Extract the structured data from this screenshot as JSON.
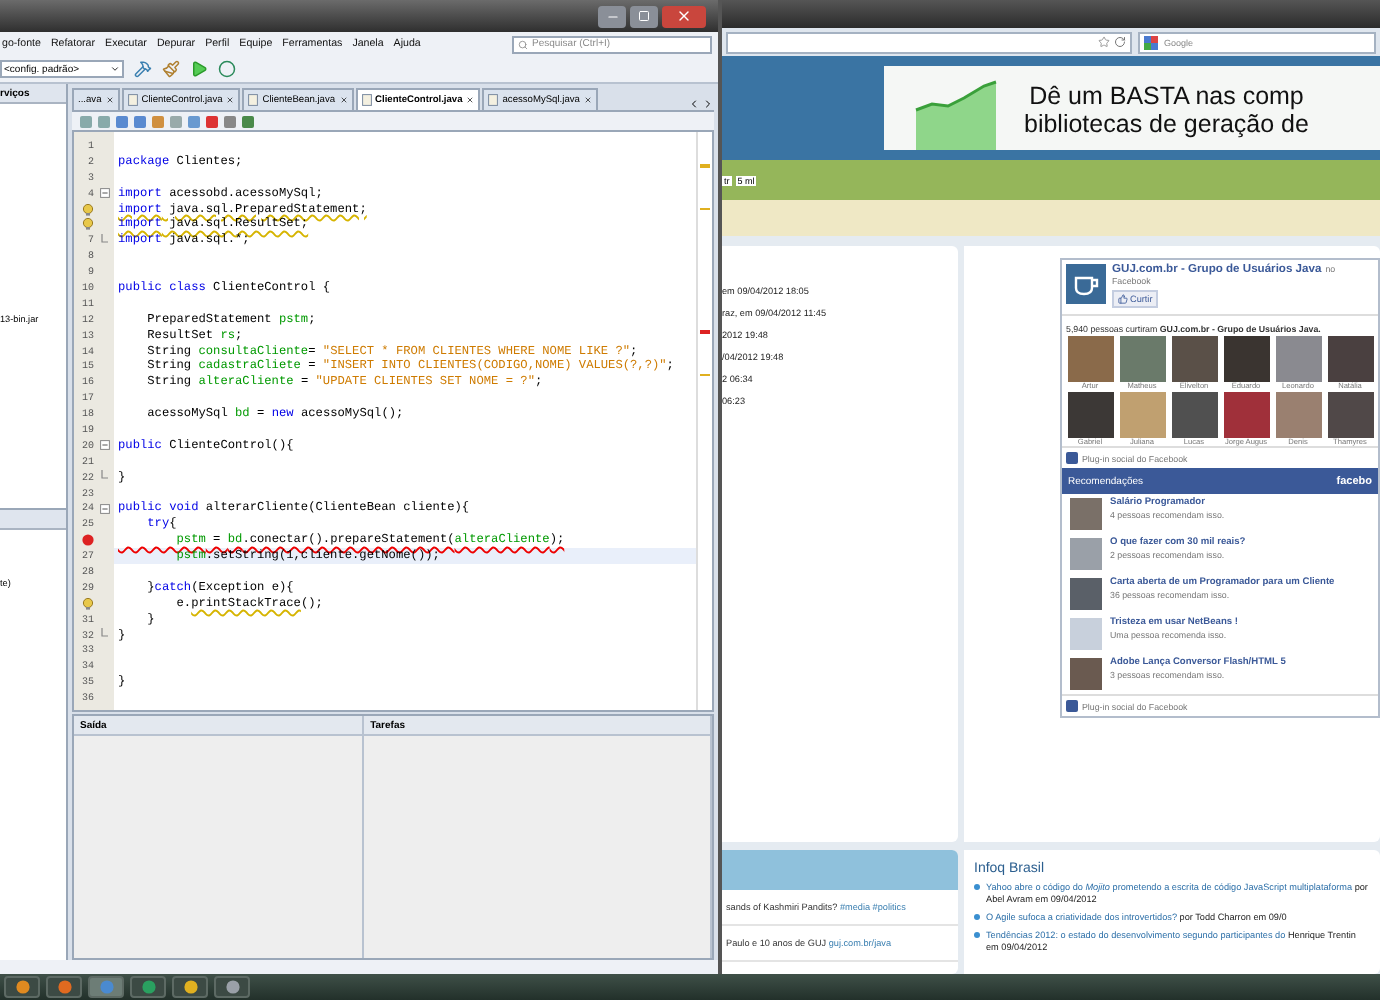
{
  "ide": {
    "menu": [
      "go-fonte",
      "Refatorar",
      "Executar",
      "Depurar",
      "Perfil",
      "Equipe",
      "Ferramentas",
      "Janela",
      "Ajuda"
    ],
    "search": {
      "placeholder": "Pesquisar (Ctrl+I)"
    },
    "config": "<config. padrão>",
    "left_panel": {
      "header": "rviços",
      "items": [
        "13-bin.jar"
      ],
      "lower_item": "te)"
    },
    "tabs": [
      {
        "label": "...ava",
        "selected": false
      },
      {
        "label": "ClienteControl.java",
        "selected": false
      },
      {
        "label": "ClienteBean.java",
        "selected": false
      },
      {
        "label": "ClienteControl.java",
        "selected": true
      },
      {
        "label": "acessoMySql.java",
        "selected": false
      }
    ],
    "code_lines": [
      {
        "n": "1",
        "kind": "plain",
        "current": false
      },
      {
        "n": "2",
        "kind": "plain",
        "current": false,
        "segs": [
          {
            "kind": "keyword",
            "text": "package"
          },
          {
            "kind": "plain",
            "text": " Clientes;"
          }
        ]
      },
      {
        "n": "3",
        "kind": "plain",
        "current": false
      },
      {
        "n": "4",
        "kind": "fold",
        "current": false,
        "segs": [
          {
            "kind": "keyword",
            "text": "import"
          },
          {
            "kind": "plain",
            "text": " acessobd.acessoMySql;"
          }
        ]
      },
      {
        "kind": "warning",
        "current": false,
        "segs": [
          {
            "kind": "keyword",
            "text": "import",
            "underline": true
          },
          {
            "kind": "plain",
            "text": " java.sql.PreparedStatement;",
            "underline": true
          }
        ]
      },
      {
        "kind": "warning",
        "current": false,
        "segs": [
          {
            "kind": "keyword",
            "text": "import",
            "underline": true
          },
          {
            "kind": "plain",
            "text": " java.sql.ResultSet;",
            "underline": true
          }
        ]
      },
      {
        "n": "7",
        "kind": "fold-end",
        "current": false,
        "segs": [
          {
            "kind": "keyword",
            "text": "import"
          },
          {
            "kind": "plain",
            "text": " java.sql.*;"
          }
        ]
      },
      {
        "n": "8",
        "kind": "plain",
        "current": false
      },
      {
        "n": "9",
        "kind": "plain",
        "current": false
      },
      {
        "n": "10",
        "kind": "plain",
        "current": false,
        "segs": [
          {
            "kind": "keyword",
            "text": "public class"
          },
          {
            "kind": "plain",
            "text": " ClienteControl {"
          }
        ]
      },
      {
        "n": "11",
        "kind": "plain",
        "current": false
      },
      {
        "n": "12",
        "kind": "plain",
        "current": false,
        "segs": [
          {
            "kind": "plain",
            "text": "    PreparedStatement "
          },
          {
            "kind": "field",
            "text": "pstm"
          },
          {
            "kind": "plain",
            "text": ";"
          }
        ]
      },
      {
        "n": "13",
        "kind": "plain",
        "current": false,
        "segs": [
          {
            "kind": "plain",
            "text": "    ResultSet "
          },
          {
            "kind": "field",
            "text": "rs"
          },
          {
            "kind": "plain",
            "text": ";"
          }
        ]
      },
      {
        "n": "14",
        "kind": "plain",
        "current": false,
        "segs": [
          {
            "kind": "plain",
            "text": "    String "
          },
          {
            "kind": "field",
            "text": "consultaCliente"
          },
          {
            "kind": "plain",
            "text": "= "
          },
          {
            "kind": "string",
            "text": "\"SELECT * FROM CLIENTES WHERE NOME LIKE ?\""
          },
          {
            "kind": "plain",
            "text": ";"
          }
        ]
      },
      {
        "n": "15",
        "kind": "plain",
        "current": false,
        "segs": [
          {
            "kind": "plain",
            "text": "    String "
          },
          {
            "kind": "field",
            "text": "cadastraCliete"
          },
          {
            "kind": "plain",
            "text": " = "
          },
          {
            "kind": "string",
            "text": "\"INSERT INTO CLIENTES(CODIGO,NOME) VALUES(?,?)\""
          },
          {
            "kind": "plain",
            "text": ";"
          }
        ]
      },
      {
        "n": "16",
        "kind": "plain",
        "current": false,
        "segs": [
          {
            "kind": "plain",
            "text": "    String "
          },
          {
            "kind": "field",
            "text": "alteraCliente"
          },
          {
            "kind": "plain",
            "text": " = "
          },
          {
            "kind": "string",
            "text": "\"UPDATE CLIENTES SET NOME = ?\""
          },
          {
            "kind": "plain",
            "text": ";"
          }
        ]
      },
      {
        "n": "17",
        "kind": "plain",
        "current": false
      },
      {
        "n": "18",
        "kind": "plain",
        "current": false,
        "segs": [
          {
            "kind": "plain",
            "text": "    acessoMySql "
          },
          {
            "kind": "field",
            "text": "bd"
          },
          {
            "kind": "plain",
            "text": " = "
          },
          {
            "kind": "keyword",
            "text": "new"
          },
          {
            "kind": "plain",
            "text": " acessoMySql();"
          }
        ]
      },
      {
        "n": "19",
        "kind": "plain",
        "current": false
      },
      {
        "n": "20",
        "kind": "fold",
        "current": false,
        "segs": [
          {
            "kind": "keyword",
            "text": "public"
          },
          {
            "kind": "plain",
            "text": " ClienteControl(){"
          }
        ]
      },
      {
        "n": "21",
        "kind": "plain",
        "current": false
      },
      {
        "n": "22",
        "kind": "fold-end",
        "current": false,
        "segs": [
          {
            "kind": "plain",
            "text": "}"
          }
        ]
      },
      {
        "n": "23",
        "kind": "plain",
        "current": false
      },
      {
        "n": "24",
        "kind": "fold",
        "current": false,
        "segs": [
          {
            "kind": "keyword",
            "text": "public void"
          },
          {
            "kind": "plain",
            "text": " alterarCliente(ClienteBean cliente){"
          }
        ]
      },
      {
        "n": "25",
        "kind": "plain",
        "current": false,
        "segs": [
          {
            "kind": "keyword",
            "text": "    try"
          },
          {
            "kind": "plain",
            "text": "{"
          }
        ]
      },
      {
        "kind": "error",
        "current": false,
        "segs": [
          {
            "kind": "field",
            "text": "        pstm",
            "underline": true
          },
          {
            "kind": "plain",
            "text": " = ",
            "underline": true
          },
          {
            "kind": "field",
            "text": "bd",
            "underline": true
          },
          {
            "kind": "plain",
            "text": ".conectar().prepareStatement(",
            "underline": true
          },
          {
            "kind": "field",
            "text": "alteraCliente",
            "underline": true
          },
          {
            "kind": "plain",
            "text": ");",
            "underline": true
          }
        ]
      },
      {
        "n": "27",
        "kind": "plain",
        "current": true,
        "segs": [
          {
            "kind": "field",
            "text": "        pstm"
          },
          {
            "kind": "plain",
            "text": ".setString(1,cliente.getNome());"
          }
        ]
      },
      {
        "n": "28",
        "kind": "plain",
        "current": false
      },
      {
        "n": "29",
        "kind": "plain",
        "current": false,
        "segs": [
          {
            "kind": "plain",
            "text": "    }"
          },
          {
            "kind": "keyword",
            "text": "catch"
          },
          {
            "kind": "plain",
            "text": "(Exception e){"
          }
        ]
      },
      {
        "kind": "warning",
        "current": false,
        "segs": [
          {
            "kind": "plain",
            "text": "        e."
          },
          {
            "kind": "plain",
            "text": "printStackTrace",
            "underline": true
          },
          {
            "kind": "plain",
            "text": "();"
          }
        ]
      },
      {
        "n": "31",
        "kind": "plain",
        "current": false,
        "segs": [
          {
            "kind": "plain",
            "text": "    }"
          }
        ]
      },
      {
        "n": "32",
        "kind": "fold-end",
        "current": false,
        "segs": [
          {
            "kind": "plain",
            "text": "}"
          }
        ]
      },
      {
        "n": "33",
        "kind": "plain",
        "current": false
      },
      {
        "n": "34",
        "kind": "plain",
        "current": false
      },
      {
        "n": "35",
        "kind": "plain",
        "current": false,
        "segs": [
          {
            "kind": "plain",
            "text": "}"
          }
        ]
      },
      {
        "n": "36",
        "kind": "plain",
        "current": false
      }
    ],
    "output_tabs": [
      "Saída",
      "Tarefas"
    ]
  },
  "browser": {
    "search": {
      "placeholder": "Google"
    },
    "banner": [
      "Dê um BASTA nas comp",
      "bibliotecas de geração de"
    ],
    "nav": [
      "tr",
      "5 ml"
    ],
    "activity": [
      "em 09/04/2012 18:05",
      "raz, em 09/04/2012 11:45",
      "2012 19:48",
      "/04/2012 19:48",
      "2 06:34",
      "06:23"
    ],
    "likebox": {
      "title": "GUJ.com.br - Grupo de Usuários Java",
      "title_suffix": "no",
      "subtitle": "Facebook",
      "like_button": "Curtir",
      "count": "5,940 pessoas curtiram **GUJ.com.br - Grupo de Usuários Java.**",
      "fans": [
        "Artur",
        "Matheus",
        "Elivelton",
        "Eduardo",
        "Leonardo",
        "Natália",
        "Gabriel",
        "Juliana",
        "Lucas",
        "Jorge Augus",
        "Denis",
        "Thamyres"
      ],
      "footer": "Plug-in social do Facebook"
    },
    "recommendations": {
      "header": "Recomendações",
      "brand": "facebo",
      "items": [
        {
          "title": "Salário Programador",
          "meta": "4 pessoas recomendam isso."
        },
        {
          "title": "O que fazer com 30 mil reais?",
          "meta": "2 pessoas recomendam isso."
        },
        {
          "title": "Carta aberta de um Programador para um Cliente",
          "meta": "36 pessoas recomendam isso."
        },
        {
          "title": "Tristeza em usar NetBeans !",
          "meta": "Uma pessoa recomenda isso."
        },
        {
          "title": "Adobe Lança Conversor Flash/HTML 5",
          "meta": "3 pessoas recomendam isso."
        }
      ],
      "footer": "Plug-in social do Facebook"
    },
    "tweets": [
      {
        "text": "sands of Kashmiri Pandits?",
        "link": "#media #politics"
      },
      {
        "text": "Paulo e 10 anos de GUJ",
        "link": "guj.com.br/java"
      }
    ],
    "infoq": {
      "title": "Infoq Brasil",
      "items": [
        {
          "link": "Yahoo abre o código do *Mojito* prometendo a escrita de código JavaScript multiplataforma",
          "meta": "por Abel Avram em 09/04/2012"
        },
        {
          "link": "O Agile sufoca a criatividade dos introvertidos?",
          "meta": "por Todd Charron em 09/0"
        },
        {
          "link": "Tendências 2012: o estado do desenvolvimento segundo participantes do",
          "meta": "Henrique Trentin em 09/04/2012"
        }
      ]
    }
  }
}
